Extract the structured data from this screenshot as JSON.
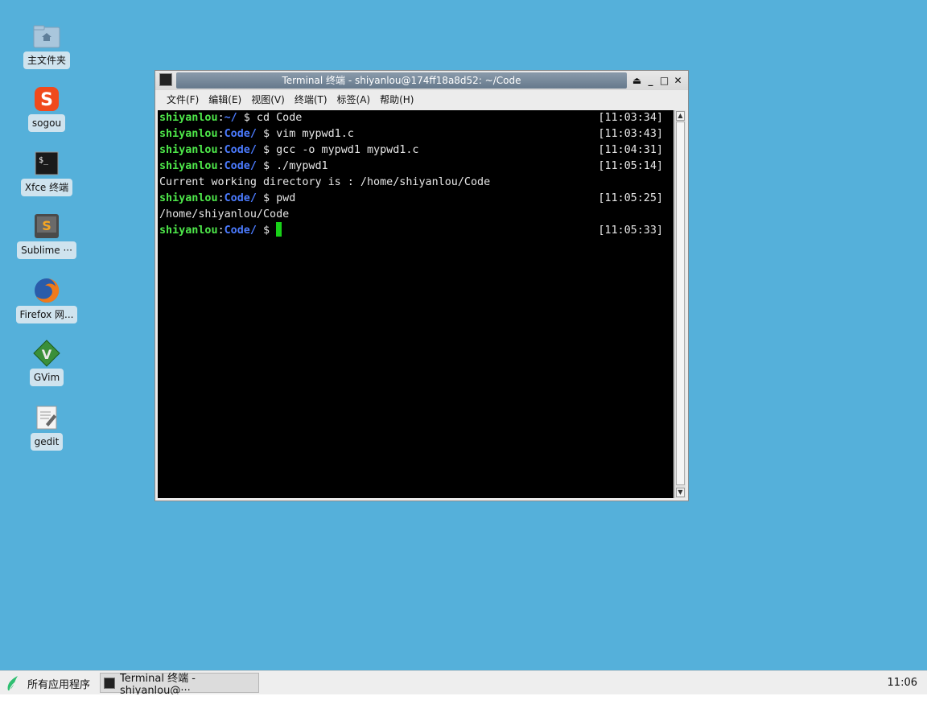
{
  "desktop": {
    "icons": [
      {
        "label": "主文件夹",
        "icon": "home-folder-icon"
      },
      {
        "label": "sogou",
        "icon": "sogou-icon"
      },
      {
        "label": "Xfce 终端",
        "icon": "terminal-icon"
      },
      {
        "label": "Sublime ···",
        "icon": "sublime-icon"
      },
      {
        "label": "Firefox 网...",
        "icon": "firefox-icon"
      },
      {
        "label": "GVim",
        "icon": "gvim-icon"
      },
      {
        "label": "gedit",
        "icon": "gedit-icon"
      }
    ]
  },
  "window": {
    "title": "Terminal 终端 - shiyanlou@174ff18a8d52: ~/Code",
    "menu": [
      "文件(F)",
      "编辑(E)",
      "视图(V)",
      "终端(T)",
      "标签(A)",
      "帮助(H)"
    ],
    "lines": [
      {
        "user": "shiyanlou",
        "path": "~/",
        "cmd": " $ cd Code",
        "time": "[11:03:34]"
      },
      {
        "user": "shiyanlou",
        "path": "Code/",
        "cmd": " $ vim mypwd1.c",
        "time": "[11:03:43]"
      },
      {
        "user": "shiyanlou",
        "path": "Code/",
        "cmd": " $ gcc -o mypwd1 mypwd1.c",
        "time": "[11:04:31]"
      },
      {
        "user": "shiyanlou",
        "path": "Code/",
        "cmd": " $ ./mypwd1",
        "time": "[11:05:14]"
      },
      {
        "output": "Current working directory is : /home/shiyanlou/Code"
      },
      {
        "user": "shiyanlou",
        "path": "Code/",
        "cmd": " $ pwd",
        "time": "[11:05:25]"
      },
      {
        "output": "/home/shiyanlou/Code"
      },
      {
        "user": "shiyanlou",
        "path": "Code/",
        "cmd": " $ ",
        "time": "[11:05:33]",
        "cursor": true
      }
    ]
  },
  "taskbar": {
    "start_label": "所有应用程序",
    "task_label": "Terminal 终端 - shiyanlou@···",
    "clock": "11:06"
  },
  "colors": {
    "desktop": "#55b0da",
    "user": "#4ee84a",
    "path": "#4b7bff",
    "cursor": "#18d018"
  }
}
